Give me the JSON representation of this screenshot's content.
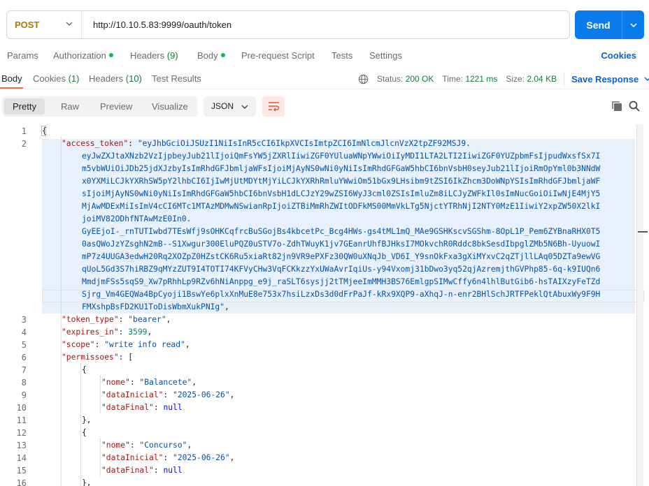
{
  "request": {
    "method": "POST",
    "url": "http://10.10.5.83:9999/oauth/token",
    "send_label": "Send"
  },
  "request_tabs": [
    {
      "label": "Params"
    },
    {
      "label": "Authorization",
      "dot": true
    },
    {
      "label": "Headers",
      "count": "(9)"
    },
    {
      "label": "Body",
      "dot": true
    },
    {
      "label": "Pre-request Script"
    },
    {
      "label": "Tests"
    },
    {
      "label": "Settings"
    }
  ],
  "cookies_link": "Cookies",
  "response_tabs": [
    {
      "label": "Body",
      "active": true
    },
    {
      "label": "Cookies",
      "count": "(1)"
    },
    {
      "label": "Headers",
      "count": "(10)"
    },
    {
      "label": "Test Results"
    }
  ],
  "status": {
    "status_label": "Status:",
    "status_value": "200 OK",
    "time_label": "Time:",
    "time_value": "1221 ms",
    "size_label": "Size:",
    "size_value": "2.04 KB",
    "save_response": "Save Response"
  },
  "view_modes": [
    "Pretty",
    "Raw",
    "Preview",
    "Visualize"
  ],
  "active_view_mode": "Pretty",
  "format": "JSON",
  "icons": {
    "globe": "globe-icon",
    "wrap": "wrap-lines-icon",
    "copy": "copy-icon",
    "search": "search-icon"
  },
  "colors": {
    "accent": "#097bed",
    "method": "#ad7a03",
    "status_ok": "#0f7d3c",
    "json_key": "#a31515",
    "json_string": "#0451a5",
    "json_number": "#098658",
    "json_keyword": "#0000ff"
  },
  "code_lines": [
    {
      "n": "1",
      "indent": 0,
      "parts": [
        [
          "p",
          "{"
        ]
      ]
    },
    {
      "n": "2",
      "indent": 1,
      "parts": [
        [
          "key",
          "\"access_token\""
        ],
        [
          "p",
          ": "
        ],
        [
          "str",
          "\"eyJhbGciOiJSUzI1NiIsInR5cCI6IkpXVCIsImtpZCI6ImNlcmJlcnVzX2tpZF92MSJ9."
        ]
      ]
    },
    {
      "n": "",
      "indent": 2,
      "parts": [
        [
          "str",
          "eyJwZXJtaXNzb2VzIjpbeyJub21lIjoiQmFsYW5jZXRlIiwiZGF0YUluaWNpYWwiOiIyMDI1LTA2LTI2IiwiZGF0YUZpbmFsIjpudWxsfSx7I"
        ]
      ]
    },
    {
      "n": "",
      "indent": 2,
      "parts": [
        [
          "str",
          "m5vbWUiOiJDb25jdXJzbyIsImRhdGFJbmljaWFsIjoiMjAyNS0wNi0yNiIsImRhdGFGaW5hbCI6bnVsbH0seyJub21lIjoiRmOpYml0b3NNdW"
        ]
      ]
    },
    {
      "n": "",
      "indent": 2,
      "parts": [
        [
          "str",
          "x0YXMiLCJkYXRhSW5pY2lhbCI6IjIwMjUtMDYtMjYiLCJkYXRhRmluYWwiOm51bGx9LHsibm9tZSI6IkZhcm3DoWNpYSIsImRhdGFJbmljaWF"
        ]
      ]
    },
    {
      "n": "",
      "indent": 2,
      "parts": [
        [
          "str",
          "sIjoiMjAyNS0wNi0yNiIsImRhdGFGaW5hbCI6bnVsbH1dLCJzY29wZSI6WyJ3cml0ZSIsImluZm8iLCJyZWFkIl0sImNucGoiOiIwNjE4MjY5"
        ]
      ]
    },
    {
      "n": "",
      "indent": 2,
      "parts": [
        [
          "str",
          "MjAwMDExMiIsImV4cCI6MTc1MTAzMDMwNSwianRpIjoiZTBiMmRhZWItODFkMS00MmVkLTg5NjctYTRhNjI2NTY0MzE1IiwiY2xpZW50X2lkI"
        ]
      ]
    },
    {
      "n": "",
      "indent": 2,
      "parts": [
        [
          "str",
          "joiMV82ODhfNTAwMzE0In0."
        ]
      ]
    },
    {
      "n": "",
      "indent": 2,
      "parts": [
        [
          "str",
          "GyEEjoI-_rnTUTIwbd7TEsWfj9sOHKCqfrcBuSGojBs4kbcetPc_Bcg4HWs-gs4tML1mQ_MAe9GSHKscvSGShm-8OpL1P_Pem6ZYBnaRHX0T5"
        ]
      ]
    },
    {
      "n": "",
      "indent": 2,
      "parts": [
        [
          "str",
          "0asQWoJzYZsghN2mB--S1Xwgur300EluPQZ0uSTV7o-ZdhTWuyK1jv7GEanrUhfBJHksI7MOkvchR0Rddc8bkSesdIbpglZMb5N6Bh-UyuowI"
        ]
      ]
    },
    {
      "n": "",
      "indent": 2,
      "parts": [
        [
          "str",
          "mP7z4UUGA3edwH20Rq2XOZpZ0HZstCK6Ru5xiaRt82jn9VR9ePXFz30QW0uXNqJb_VD6I_Y9snOkFxa3gXiMYxvC2qZTjllLAq05DZTa9ewVG"
        ]
      ]
    },
    {
      "n": "",
      "indent": 2,
      "parts": [
        [
          "str",
          "qUoL5Gd3S7hiRBZ9qMYzZUT9I4TOTI74KFVyCHw3VqFCKkzzYxUWaAvrIqiUs-y94Vxomj31bDwo3yq52qjAzremjthGVPhp85-6q-k9IUQn6"
        ]
      ]
    },
    {
      "n": "",
      "indent": 2,
      "parts": [
        [
          "str",
          "MmdjmFSs5sqS9_Xw7pRhhLp9RZv6hNiAnppg_e9j_raSLT6sysjj2tTMjeeImMMH3BS76EmlgpSIMwCffy6n4lhlButGib6-hsTAIXzyFeTZd"
        ]
      ]
    },
    {
      "n": "",
      "indent": 2,
      "parts": [
        [
          "str",
          "Sjrg_Vm4GEQWa4BpCyoji1BswYe6plxXnMuE8e753x7hsiLzxDs3d0dFrPaJf-kRx9XQP9-aXhqJ-n-enr2BHlSchJRTFPeklQtAbuxWy9F9H"
        ]
      ]
    },
    {
      "n": "",
      "indent": 2,
      "parts": [
        [
          "str",
          "FMXshpBsFD2KU1ToDisWbmXukPNIg\""
        ],
        [
          "p",
          ","
        ]
      ]
    },
    {
      "n": "3",
      "indent": 1,
      "parts": [
        [
          "key",
          "\"token_type\""
        ],
        [
          "p",
          ": "
        ],
        [
          "str",
          "\"bearer\""
        ],
        [
          "p",
          ","
        ]
      ]
    },
    {
      "n": "4",
      "indent": 1,
      "parts": [
        [
          "key",
          "\"expires_in\""
        ],
        [
          "p",
          ": "
        ],
        [
          "num",
          "3599"
        ],
        [
          "p",
          ","
        ]
      ]
    },
    {
      "n": "5",
      "indent": 1,
      "parts": [
        [
          "key",
          "\"scope\""
        ],
        [
          "p",
          ": "
        ],
        [
          "str",
          "\"write info read\""
        ],
        [
          "p",
          ","
        ]
      ]
    },
    {
      "n": "6",
      "indent": 1,
      "parts": [
        [
          "key",
          "\"permissoes\""
        ],
        [
          "p",
          ": ["
        ]
      ]
    },
    {
      "n": "7",
      "indent": 2,
      "parts": [
        [
          "p",
          "{"
        ]
      ]
    },
    {
      "n": "8",
      "indent": 3,
      "parts": [
        [
          "key",
          "\"nome\""
        ],
        [
          "p",
          ": "
        ],
        [
          "str",
          "\"Balancete\""
        ],
        [
          "p",
          ","
        ]
      ]
    },
    {
      "n": "9",
      "indent": 3,
      "parts": [
        [
          "key",
          "\"dataInicial\""
        ],
        [
          "p",
          ": "
        ],
        [
          "str",
          "\"2025-06-26\""
        ],
        [
          "p",
          ","
        ]
      ]
    },
    {
      "n": "10",
      "indent": 3,
      "parts": [
        [
          "key",
          "\"dataFinal\""
        ],
        [
          "p",
          ": "
        ],
        [
          "kw",
          "null"
        ]
      ]
    },
    {
      "n": "11",
      "indent": 2,
      "parts": [
        [
          "p",
          "},"
        ]
      ]
    },
    {
      "n": "12",
      "indent": 2,
      "parts": [
        [
          "p",
          "{"
        ]
      ]
    },
    {
      "n": "13",
      "indent": 3,
      "parts": [
        [
          "key",
          "\"nome\""
        ],
        [
          "p",
          ": "
        ],
        [
          "str",
          "\"Concurso\""
        ],
        [
          "p",
          ","
        ]
      ]
    },
    {
      "n": "14",
      "indent": 3,
      "parts": [
        [
          "key",
          "\"dataInicial\""
        ],
        [
          "p",
          ": "
        ],
        [
          "str",
          "\"2025-06-26\""
        ],
        [
          "p",
          ","
        ]
      ]
    },
    {
      "n": "15",
      "indent": 3,
      "parts": [
        [
          "key",
          "\"dataFinal\""
        ],
        [
          "p",
          ": "
        ],
        [
          "kw",
          "null"
        ]
      ]
    },
    {
      "n": "16",
      "indent": 2,
      "parts": [
        [
          "p",
          "},"
        ]
      ]
    }
  ]
}
